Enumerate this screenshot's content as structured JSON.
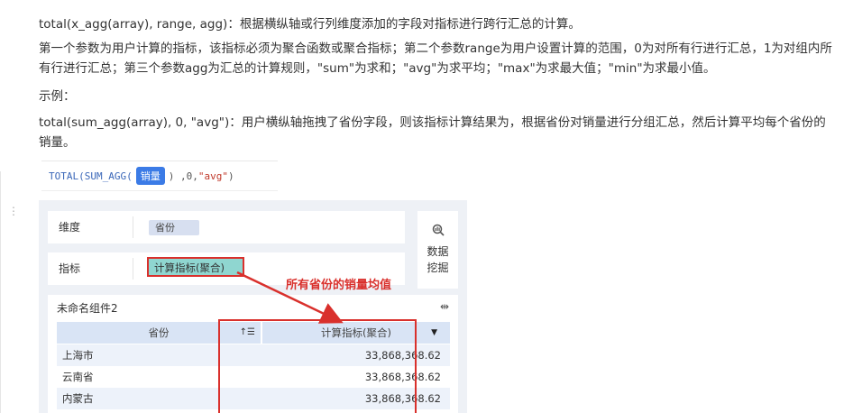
{
  "doc": {
    "line1": "total(x_agg(array), range, agg)：根据横纵轴或行列维度添加的字段对指标进行跨行汇总的计算。",
    "line2": "第一个参数为用户计算的指标，该指标必须为聚合函数或聚合指标；第二个参数range为用户设置计算的范围，0为对所有行进行汇总，1为对组内所有行进行汇总；第三个参数agg为汇总的计算规则，\"sum\"为求和；\"avg\"为求平均；\"max\"为求最大值；\"min\"为求最小值。",
    "line3": "示例：",
    "line4": "total(sum_agg(array), 0, \"avg\")：用户横纵轴拖拽了省份字段，则该指标计算结果为，根据省份对销量进行分组汇总，然后计算平均每个省份的销量。"
  },
  "formula": {
    "prefix": "TOTAL(SUM_AGG(",
    "field": "销量",
    "suffix_a": ") ,0,",
    "suffix_str": "\"avg\"",
    "suffix_b": ")"
  },
  "panel": {
    "dimension_label": "维度",
    "dimension_value": "省份",
    "metric_label": "指标",
    "metric_value": "计算指标(聚合)",
    "mining_label_1": "数据",
    "mining_label_2": "挖掘",
    "annotation": "所有省份的销量均值"
  },
  "table": {
    "title": "未命名组件2",
    "headers": [
      "省份",
      "计算指标(聚合)"
    ],
    "rows": [
      [
        "上海市",
        "33,868,368.62"
      ],
      [
        "云南省",
        "33,868,368.62"
      ],
      [
        "内蒙古",
        "33,868,368.62"
      ]
    ]
  },
  "colors": {
    "accent": "#3b7be6",
    "highlight": "#d9302c",
    "metric_pill": "#8fd6d0"
  }
}
